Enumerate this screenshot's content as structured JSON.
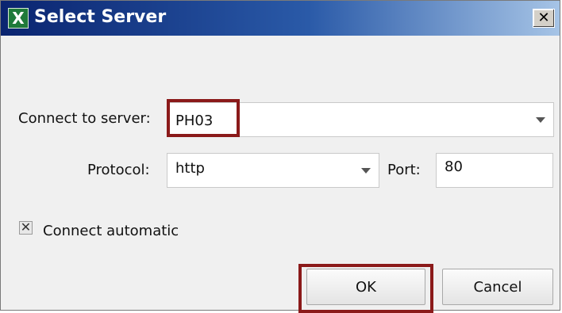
{
  "dialog": {
    "title": "Select Server",
    "app_icon": "excel-x-icon",
    "close_icon": "close-icon"
  },
  "form": {
    "server_label": "Connect to server:",
    "server_value": "PH03",
    "protocol_label": "Protocol:",
    "protocol_value": "http",
    "port_label": "Port:",
    "port_value": "80",
    "auto_connect_label": "Connect automatic",
    "auto_connect_checked": true
  },
  "buttons": {
    "ok": "OK",
    "cancel": "Cancel"
  },
  "colors": {
    "highlight": "#8b1a1a",
    "titlebar_start": "#0a2470",
    "titlebar_end": "#a6c4e6"
  }
}
